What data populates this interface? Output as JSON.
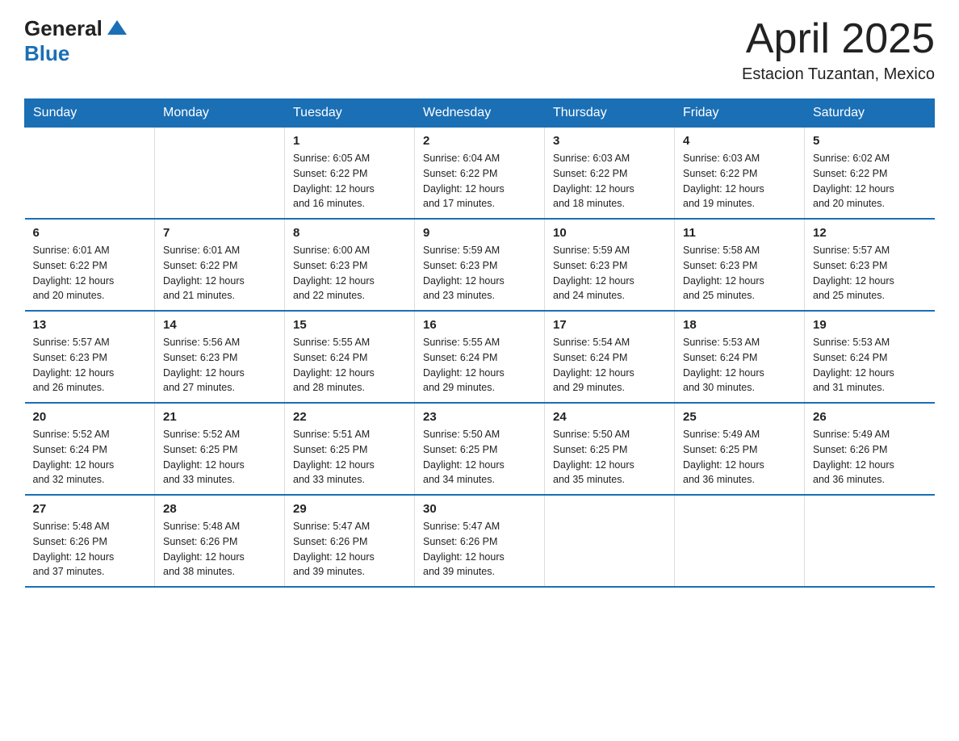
{
  "logo": {
    "general": "General",
    "blue": "Blue"
  },
  "title": "April 2025",
  "location": "Estacion Tuzantan, Mexico",
  "headers": [
    "Sunday",
    "Monday",
    "Tuesday",
    "Wednesday",
    "Thursday",
    "Friday",
    "Saturday"
  ],
  "weeks": [
    [
      {
        "day": "",
        "info": ""
      },
      {
        "day": "",
        "info": ""
      },
      {
        "day": "1",
        "info": "Sunrise: 6:05 AM\nSunset: 6:22 PM\nDaylight: 12 hours\nand 16 minutes."
      },
      {
        "day": "2",
        "info": "Sunrise: 6:04 AM\nSunset: 6:22 PM\nDaylight: 12 hours\nand 17 minutes."
      },
      {
        "day": "3",
        "info": "Sunrise: 6:03 AM\nSunset: 6:22 PM\nDaylight: 12 hours\nand 18 minutes."
      },
      {
        "day": "4",
        "info": "Sunrise: 6:03 AM\nSunset: 6:22 PM\nDaylight: 12 hours\nand 19 minutes."
      },
      {
        "day": "5",
        "info": "Sunrise: 6:02 AM\nSunset: 6:22 PM\nDaylight: 12 hours\nand 20 minutes."
      }
    ],
    [
      {
        "day": "6",
        "info": "Sunrise: 6:01 AM\nSunset: 6:22 PM\nDaylight: 12 hours\nand 20 minutes."
      },
      {
        "day": "7",
        "info": "Sunrise: 6:01 AM\nSunset: 6:22 PM\nDaylight: 12 hours\nand 21 minutes."
      },
      {
        "day": "8",
        "info": "Sunrise: 6:00 AM\nSunset: 6:23 PM\nDaylight: 12 hours\nand 22 minutes."
      },
      {
        "day": "9",
        "info": "Sunrise: 5:59 AM\nSunset: 6:23 PM\nDaylight: 12 hours\nand 23 minutes."
      },
      {
        "day": "10",
        "info": "Sunrise: 5:59 AM\nSunset: 6:23 PM\nDaylight: 12 hours\nand 24 minutes."
      },
      {
        "day": "11",
        "info": "Sunrise: 5:58 AM\nSunset: 6:23 PM\nDaylight: 12 hours\nand 25 minutes."
      },
      {
        "day": "12",
        "info": "Sunrise: 5:57 AM\nSunset: 6:23 PM\nDaylight: 12 hours\nand 25 minutes."
      }
    ],
    [
      {
        "day": "13",
        "info": "Sunrise: 5:57 AM\nSunset: 6:23 PM\nDaylight: 12 hours\nand 26 minutes."
      },
      {
        "day": "14",
        "info": "Sunrise: 5:56 AM\nSunset: 6:23 PM\nDaylight: 12 hours\nand 27 minutes."
      },
      {
        "day": "15",
        "info": "Sunrise: 5:55 AM\nSunset: 6:24 PM\nDaylight: 12 hours\nand 28 minutes."
      },
      {
        "day": "16",
        "info": "Sunrise: 5:55 AM\nSunset: 6:24 PM\nDaylight: 12 hours\nand 29 minutes."
      },
      {
        "day": "17",
        "info": "Sunrise: 5:54 AM\nSunset: 6:24 PM\nDaylight: 12 hours\nand 29 minutes."
      },
      {
        "day": "18",
        "info": "Sunrise: 5:53 AM\nSunset: 6:24 PM\nDaylight: 12 hours\nand 30 minutes."
      },
      {
        "day": "19",
        "info": "Sunrise: 5:53 AM\nSunset: 6:24 PM\nDaylight: 12 hours\nand 31 minutes."
      }
    ],
    [
      {
        "day": "20",
        "info": "Sunrise: 5:52 AM\nSunset: 6:24 PM\nDaylight: 12 hours\nand 32 minutes."
      },
      {
        "day": "21",
        "info": "Sunrise: 5:52 AM\nSunset: 6:25 PM\nDaylight: 12 hours\nand 33 minutes."
      },
      {
        "day": "22",
        "info": "Sunrise: 5:51 AM\nSunset: 6:25 PM\nDaylight: 12 hours\nand 33 minutes."
      },
      {
        "day": "23",
        "info": "Sunrise: 5:50 AM\nSunset: 6:25 PM\nDaylight: 12 hours\nand 34 minutes."
      },
      {
        "day": "24",
        "info": "Sunrise: 5:50 AM\nSunset: 6:25 PM\nDaylight: 12 hours\nand 35 minutes."
      },
      {
        "day": "25",
        "info": "Sunrise: 5:49 AM\nSunset: 6:25 PM\nDaylight: 12 hours\nand 36 minutes."
      },
      {
        "day": "26",
        "info": "Sunrise: 5:49 AM\nSunset: 6:26 PM\nDaylight: 12 hours\nand 36 minutes."
      }
    ],
    [
      {
        "day": "27",
        "info": "Sunrise: 5:48 AM\nSunset: 6:26 PM\nDaylight: 12 hours\nand 37 minutes."
      },
      {
        "day": "28",
        "info": "Sunrise: 5:48 AM\nSunset: 6:26 PM\nDaylight: 12 hours\nand 38 minutes."
      },
      {
        "day": "29",
        "info": "Sunrise: 5:47 AM\nSunset: 6:26 PM\nDaylight: 12 hours\nand 39 minutes."
      },
      {
        "day": "30",
        "info": "Sunrise: 5:47 AM\nSunset: 6:26 PM\nDaylight: 12 hours\nand 39 minutes."
      },
      {
        "day": "",
        "info": ""
      },
      {
        "day": "",
        "info": ""
      },
      {
        "day": "",
        "info": ""
      }
    ]
  ]
}
